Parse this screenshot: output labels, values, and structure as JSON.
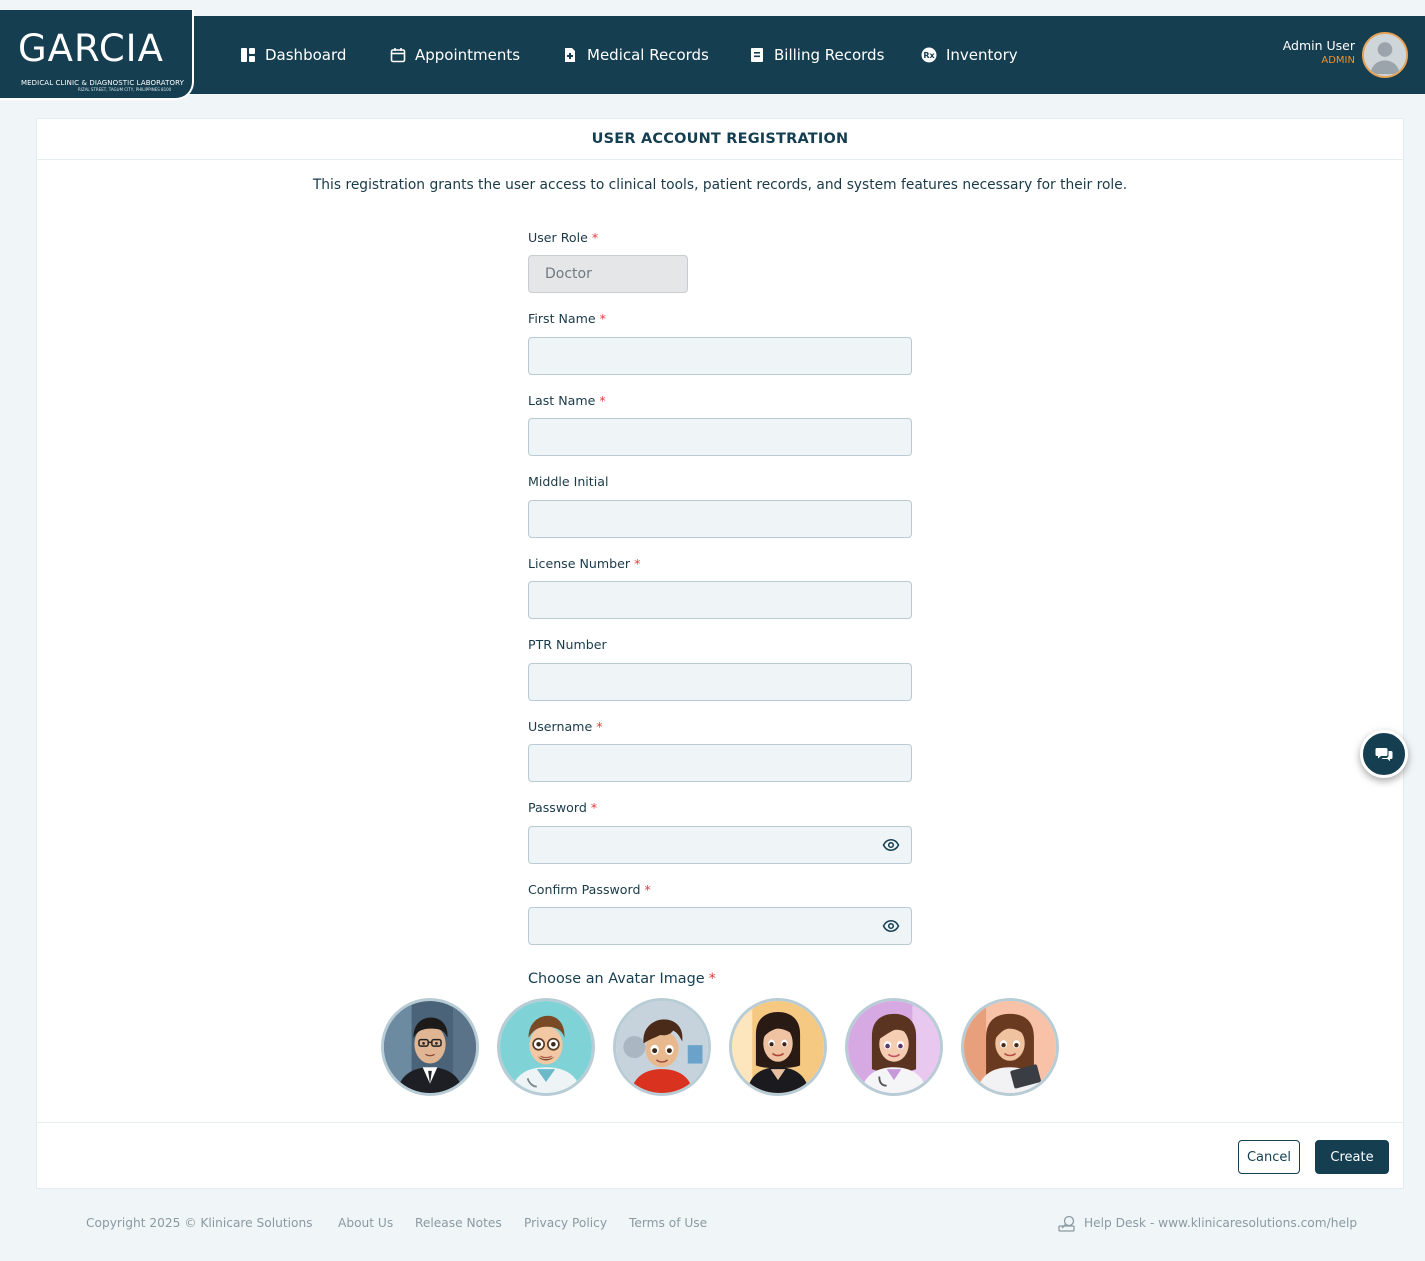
{
  "brand": {
    "name": "GARCIA",
    "subtitle": "MEDICAL CLINIC & DIAGNOSTIC LABORATORY",
    "address": "RIZAL STREET, TAGUM CITY, PHILIPPINES 8100"
  },
  "nav": {
    "items": [
      {
        "label": "Dashboard",
        "icon": "dashboard-icon"
      },
      {
        "label": "Appointments",
        "icon": "calendar-icon"
      },
      {
        "label": "Medical Records",
        "icon": "medical-file-icon"
      },
      {
        "label": "Billing Records",
        "icon": "billing-icon"
      },
      {
        "label": "Inventory",
        "icon": "rx-icon"
      }
    ]
  },
  "user": {
    "name": "Admin User",
    "role": "ADMIN"
  },
  "form": {
    "title": "USER ACCOUNT REGISTRATION",
    "intro": "This registration grants the user access to clinical tools, patient records, and system features necessary for their role.",
    "user_role": {
      "label": "User Role",
      "required": "*",
      "value": "Doctor"
    },
    "first_name": {
      "label": "First Name",
      "required": "*",
      "value": ""
    },
    "last_name": {
      "label": "Last Name",
      "required": "*",
      "value": ""
    },
    "middle_initial": {
      "label": "Middle Initial",
      "value": ""
    },
    "license_number": {
      "label": "License Number",
      "required": "*",
      "value": ""
    },
    "ptr_number": {
      "label": "PTR Number",
      "value": ""
    },
    "username": {
      "label": "Username",
      "required": "*",
      "value": ""
    },
    "password": {
      "label": "Password",
      "required": "*",
      "value": ""
    },
    "confirm_password": {
      "label": "Confirm Password",
      "required": "*",
      "value": ""
    },
    "avatar": {
      "label": "Choose an Avatar Image",
      "required": "*",
      "options": [
        "avatar-man-suit",
        "avatar-doctor-glasses",
        "avatar-boy",
        "avatar-woman-business",
        "avatar-woman-doctor",
        "avatar-woman-clipboard"
      ]
    },
    "cancel_label": "Cancel",
    "create_label": "Create"
  },
  "footer": {
    "copyright": "Copyright 2025 © Klinicare Solutions",
    "links": [
      "About Us",
      "Release Notes",
      "Privacy Policy",
      "Terms of Use"
    ],
    "help": "Help Desk - www.klinicaresolutions.com/help"
  },
  "colors": {
    "navy": "#153e50",
    "accent_orange": "#f0932b",
    "required_red": "#e23c3c",
    "page_bg": "#f0f5f7"
  }
}
